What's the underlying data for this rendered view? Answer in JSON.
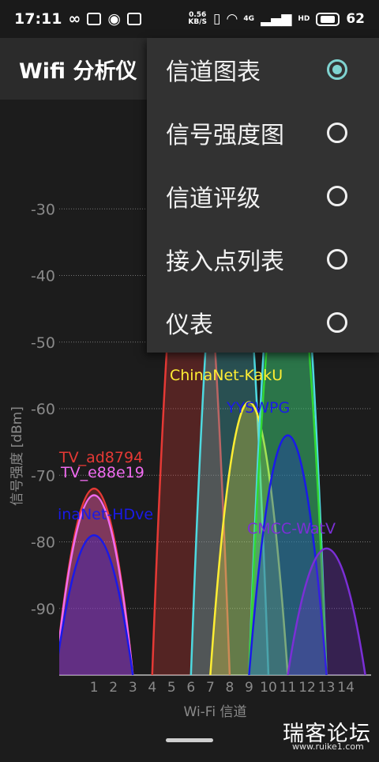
{
  "status_bar": {
    "time": "17:11",
    "net_speed_value": "0.56",
    "net_speed_unit": "KB/S",
    "network_label": "4G",
    "hd_label": "HD",
    "battery": "62",
    "icons": [
      "infinity-icon",
      "mail-icon",
      "app-icon",
      "notification-icon",
      "vibrate-icon",
      "wifi-icon",
      "signal-icon",
      "battery-icon"
    ]
  },
  "app_bar": {
    "title": "Wifi 分析仪"
  },
  "menu": {
    "items": [
      {
        "label": "信道图表",
        "selected": true
      },
      {
        "label": "信号强度图",
        "selected": false
      },
      {
        "label": "信道评级",
        "selected": false
      },
      {
        "label": "接入点列表",
        "selected": false
      },
      {
        "label": "仪表",
        "selected": false
      }
    ]
  },
  "watermark": {
    "text": "瑞客论坛",
    "url": "www.ruike1.com"
  },
  "chart_data": {
    "type": "area",
    "xlabel": "Wi-Fi 信道",
    "ylabel": "信号强度 [dBm]",
    "xlim": [
      -0.8,
      15.3
    ],
    "ylim": [
      -100,
      -20
    ],
    "x_ticks": [
      1,
      2,
      3,
      4,
      5,
      6,
      7,
      8,
      9,
      10,
      11,
      12,
      13,
      14
    ],
    "y_ticks": [
      -30,
      -40,
      -50,
      -60,
      -70,
      -80,
      -90
    ],
    "grid": "horizontal dotted",
    "series": [
      {
        "name": "TV_ad8794",
        "channel": 1,
        "level": -72,
        "color": "#e53935"
      },
      {
        "name": "TV_e88e19",
        "channel": 1,
        "level": -73,
        "color": "#f06bf0"
      },
      {
        "name": "inaNet-HDve",
        "channel": 1,
        "level": -79,
        "color": "#1a1ae8"
      },
      {
        "name": "",
        "channel": 6,
        "level": -20,
        "color": "#e53935"
      },
      {
        "name": "",
        "channel": 8,
        "level": -20,
        "color": "#4dd9e0"
      },
      {
        "name": "ChinaNet-KakU",
        "channel": 9,
        "level": -59,
        "color": "#ffee33"
      },
      {
        "name": "",
        "channel": 11,
        "level": -20,
        "color": "#4dd9e0"
      },
      {
        "name": "",
        "channel": 11,
        "level": -30,
        "color": "#33d633"
      },
      {
        "name": "YYSWPG",
        "channel": 11,
        "level": -64,
        "color": "#1a1ae8"
      },
      {
        "name": "CMCC-WatV",
        "channel": 13,
        "level": -81,
        "color": "#7b2fd6"
      }
    ]
  }
}
